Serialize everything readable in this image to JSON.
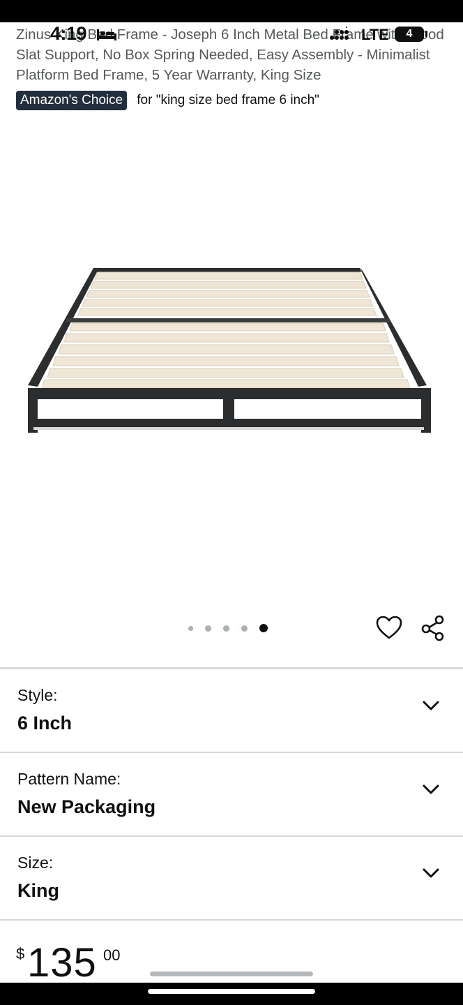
{
  "status_bar": {
    "time": "4:19",
    "network": "LTE",
    "battery": "4"
  },
  "product": {
    "title": "Zinus King Bed Frame - Joseph 6 Inch Metal Bed Frame with Wood Slat Support, No Box Spring Needed, Easy Assembly - Minimalist Platform Bed Frame, 5 Year Warranty, King Size",
    "badge": "Amazon's Choice",
    "badge_query": "for \"king size bed frame 6 inch\"",
    "image_icon": "bed-frame-product-image",
    "carousel": {
      "count": 5,
      "active_index": 5
    }
  },
  "actions": {
    "wishlist_icon": "heart-icon",
    "share_icon": "share-icon"
  },
  "options": [
    {
      "label": "Style:",
      "value": "6 Inch"
    },
    {
      "label": "Pattern Name:",
      "value": "New Packaging"
    },
    {
      "label": "Size:",
      "value": "King"
    }
  ],
  "price": {
    "symbol": "$",
    "whole": "135",
    "fraction": "00"
  },
  "colors": {
    "badge_bg": "#232f3e",
    "title_text": "#565959",
    "frame_metal": "#2b2d2f",
    "wood_slat": "#efe6d6"
  }
}
